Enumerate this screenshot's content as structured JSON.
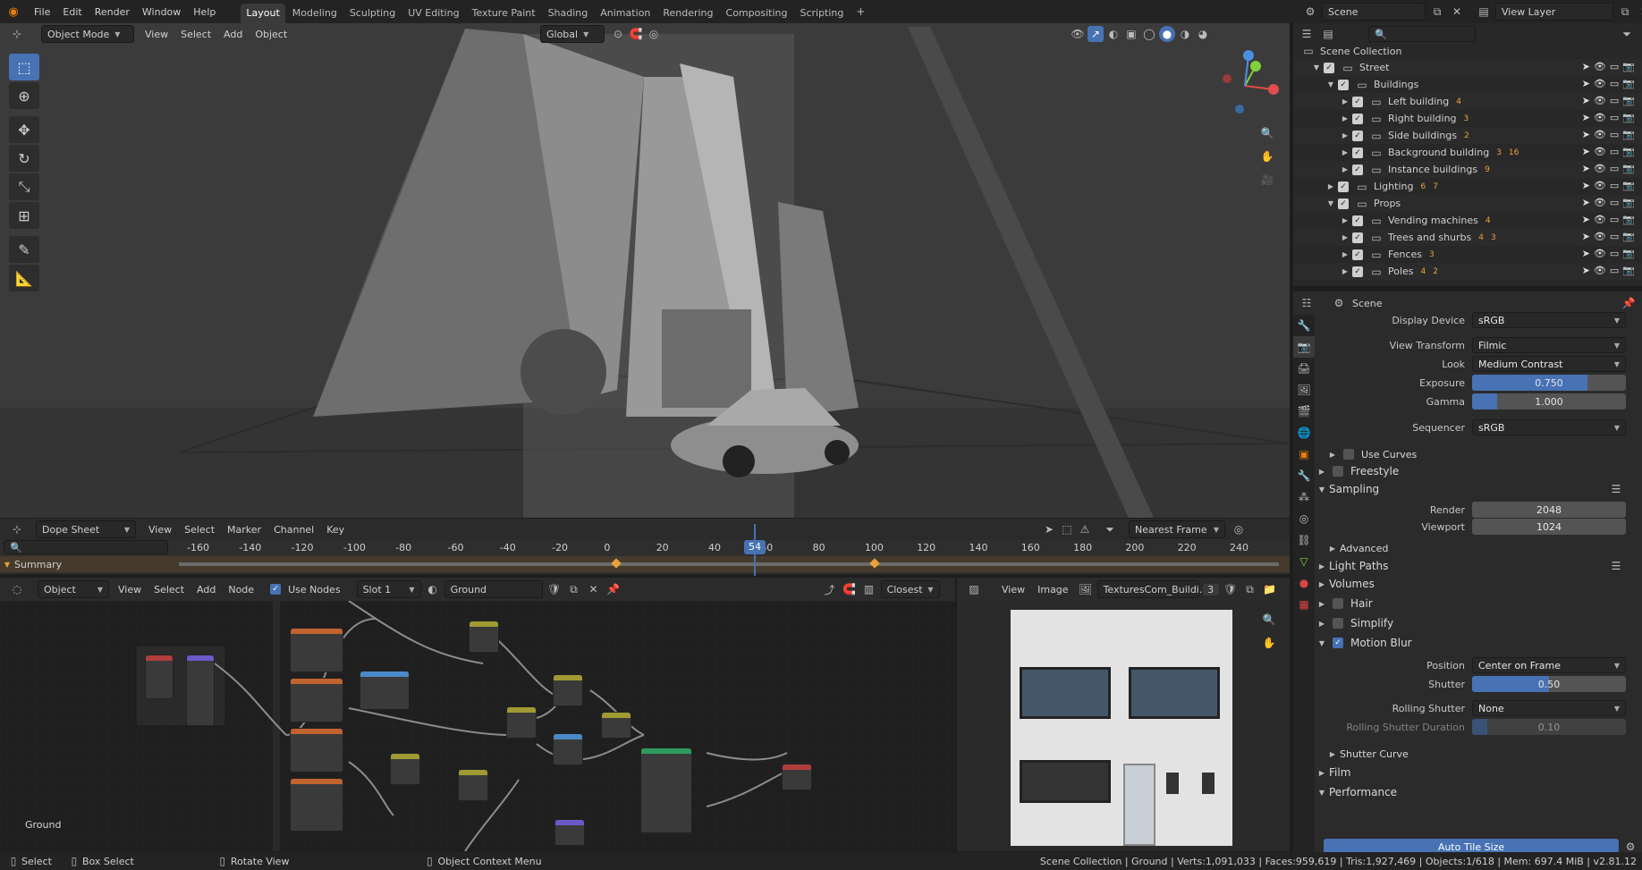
{
  "menu": [
    "File",
    "Edit",
    "Render",
    "Window",
    "Help"
  ],
  "workspaces": [
    "Layout",
    "Modeling",
    "Sculpting",
    "UV Editing",
    "Texture Paint",
    "Shading",
    "Animation",
    "Rendering",
    "Compositing",
    "Scripting"
  ],
  "active_workspace": "Layout",
  "scene_name": "Scene",
  "view_layer": "View Layer",
  "viewport": {
    "mode": "Object Mode",
    "menus": [
      "View",
      "Select",
      "Add",
      "Object"
    ],
    "orientation": "Global"
  },
  "outliner": {
    "root": "Scene Collection",
    "rows": [
      {
        "label": "Street",
        "depth": 0,
        "expanded": true,
        "badges": []
      },
      {
        "label": "Buildings",
        "depth": 1,
        "expanded": true,
        "badges": []
      },
      {
        "label": "Left building",
        "depth": 2,
        "expanded": false,
        "badges": [
          "4"
        ]
      },
      {
        "label": "Right building",
        "depth": 2,
        "expanded": false,
        "badges": [
          "3"
        ]
      },
      {
        "label": "Side buildings",
        "depth": 2,
        "expanded": false,
        "badges": [
          "2"
        ]
      },
      {
        "label": "Background building",
        "depth": 2,
        "expanded": false,
        "badges": [
          "3",
          "16"
        ]
      },
      {
        "label": "Instance buildings",
        "depth": 2,
        "expanded": false,
        "badges": [
          "9"
        ]
      },
      {
        "label": "Lighting",
        "depth": 1,
        "expanded": false,
        "badges": [
          "6",
          "7"
        ]
      },
      {
        "label": "Props",
        "depth": 1,
        "expanded": true,
        "badges": []
      },
      {
        "label": "Vending machines",
        "depth": 2,
        "expanded": false,
        "badges": [
          "4"
        ]
      },
      {
        "label": "Trees and shurbs",
        "depth": 2,
        "expanded": false,
        "badges": [
          "4",
          "3"
        ]
      },
      {
        "label": "Fences",
        "depth": 2,
        "expanded": false,
        "badges": [
          "3"
        ]
      },
      {
        "label": "Poles",
        "depth": 2,
        "expanded": false,
        "badges": [
          "4",
          "2"
        ]
      }
    ]
  },
  "properties": {
    "context": "Scene",
    "display_device_label": "Display Device",
    "display_device": "sRGB",
    "view_transform_label": "View Transform",
    "view_transform": "Filmic",
    "look_label": "Look",
    "look": "Medium Contrast",
    "exposure_label": "Exposure",
    "exposure": "0.750",
    "exposure_fill": 0.75,
    "gamma_label": "Gamma",
    "gamma": "1.000",
    "gamma_fill": 0.16,
    "sequencer_label": "Sequencer",
    "sequencer": "sRGB",
    "use_curves": "Use Curves",
    "panels": {
      "freestyle": "Freestyle",
      "sampling": "Sampling",
      "advanced": "Advanced",
      "light_paths": "Light Paths",
      "volumes": "Volumes",
      "hair": "Hair",
      "simplify": "Simplify",
      "motion_blur": "Motion Blur",
      "shutter_curve": "Shutter Curve",
      "film": "Film",
      "performance": "Performance"
    },
    "render_label": "Render",
    "render": "2048",
    "viewport_label": "Viewport",
    "viewport": "1024",
    "position_label": "Position",
    "position": "Center on Frame",
    "shutter_label": "Shutter",
    "shutter": "0.50",
    "shutter_fill": 0.5,
    "rolling_shutter_label": "Rolling Shutter",
    "rolling_shutter": "None",
    "rolling_duration_label": "Rolling Shutter Duration",
    "rolling_duration": "0.10",
    "rolling_fill": 0.1,
    "auto_tile": "Auto Tile Size"
  },
  "dopesheet": {
    "editor": "Dope Sheet",
    "menus": [
      "View",
      "Select",
      "Marker",
      "Channel",
      "Key"
    ],
    "snap": "Nearest Frame",
    "ticks": [
      "-160",
      "-140",
      "-120",
      "-100",
      "-80",
      "-60",
      "-40",
      "-20",
      "0",
      "20",
      "40",
      "60",
      "80",
      "100",
      "120",
      "140",
      "160",
      "180",
      "200",
      "220",
      "240"
    ],
    "current_frame": "54",
    "summary": "Summary"
  },
  "nodeeditor": {
    "type": "Object",
    "menus": [
      "View",
      "Select",
      "Add",
      "Node"
    ],
    "use_nodes": "Use Nodes",
    "slot": "Slot 1",
    "material": "Ground",
    "interp": "Closest",
    "footer_label": "Ground"
  },
  "imageeditor": {
    "menus": [
      "View",
      "Image"
    ],
    "image_name": "TexturesCom_Buildi...",
    "users": "3"
  },
  "statusbar": {
    "select": "Select",
    "box_select": "Box Select",
    "rotate": "Rotate View",
    "context_menu": "Object Context Menu",
    "stats": "Scene Collection | Ground | Verts:1,091,033 | Faces:959,619 | Tris:1,927,469 | Objects:1/618 | Mem: 697.4 MiB | v2.81.12"
  }
}
